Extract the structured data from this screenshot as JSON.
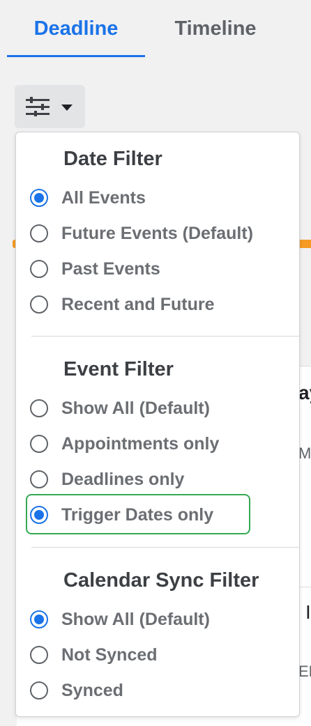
{
  "tabs": [
    {
      "label": "Deadline",
      "active": true
    },
    {
      "label": "Timeline",
      "active": false
    }
  ],
  "filter_button": {
    "icon": "sliders-icon",
    "dropdown_icon": "chevron-down-icon"
  },
  "background": {
    "text_a": "ay",
    "text_b": "MS",
    "text_c": "I",
    "text_d": "EN"
  },
  "date_filter": {
    "title": "Date Filter",
    "options": [
      "All Events",
      "Future Events (Default)",
      "Past Events",
      "Recent and Future"
    ],
    "selected": "All Events"
  },
  "event_filter": {
    "title": "Event Filter",
    "options": [
      "Show All (Default)",
      "Appointments only",
      "Deadlines only",
      "Trigger Dates only"
    ],
    "selected": "Trigger Dates only"
  },
  "calendar_sync_filter": {
    "title": "Calendar Sync Filter",
    "options": [
      "Show All (Default)",
      "Not Synced",
      "Synced"
    ],
    "selected": "Show All (Default)"
  },
  "colors": {
    "accent": "#1a73e8",
    "highlight": "#34a853",
    "orange": "#f59a23"
  }
}
